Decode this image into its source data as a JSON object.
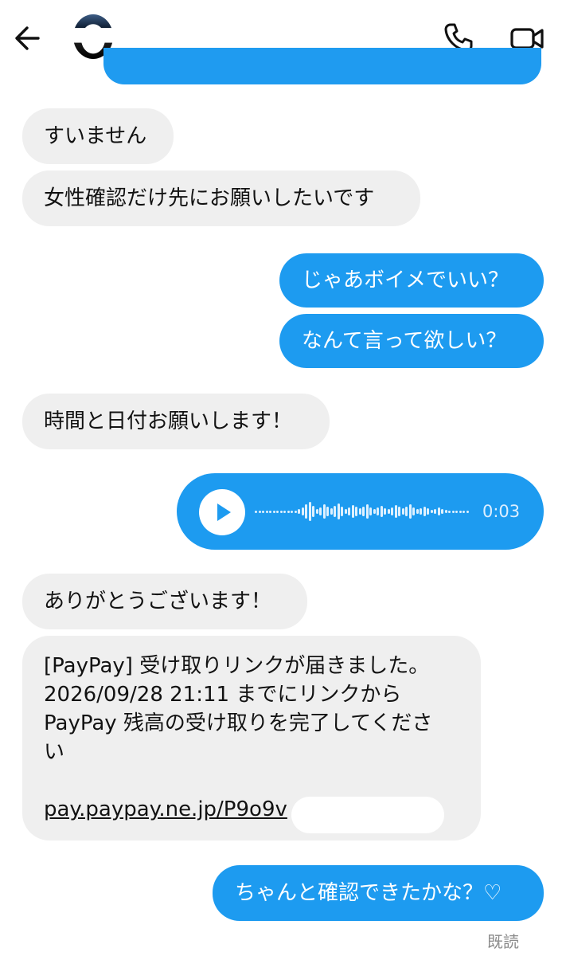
{
  "header": {
    "back_icon": "arrow-left-icon",
    "call_icon": "phone-icon",
    "video_icon": "video-camera-icon"
  },
  "colors": {
    "outgoing_bubble": "#1d9bf0",
    "incoming_bubble": "#efefef",
    "seen_text": "#8a8a8a"
  },
  "messages": [
    {
      "from": "them",
      "text": "すいません"
    },
    {
      "from": "them",
      "text": "女性確認だけ先にお願いしたいです"
    },
    {
      "from": "me",
      "text": "じゃあボイメでいい？"
    },
    {
      "from": "me",
      "text": "なんて言って欲しい？"
    },
    {
      "from": "them",
      "text": "時間と日付お願いします！"
    },
    {
      "from": "me",
      "type": "voice",
      "duration": "0:03"
    },
    {
      "from": "them",
      "text": "ありがとうございます！"
    },
    {
      "from": "them",
      "type": "paypay",
      "lines": [
        "[PayPay] 受け取りリンクが届きました。",
        "2026/09/28 21:11 までにリンクから",
        "PayPay 残高の受け取りを完了してくださ",
        "い"
      ],
      "link": "pay.paypay.ne.jp/P9o9v"
    },
    {
      "from": "me",
      "text": "ちゃんと確認できたかな？♡"
    }
  ],
  "status": {
    "seen": "既読"
  }
}
